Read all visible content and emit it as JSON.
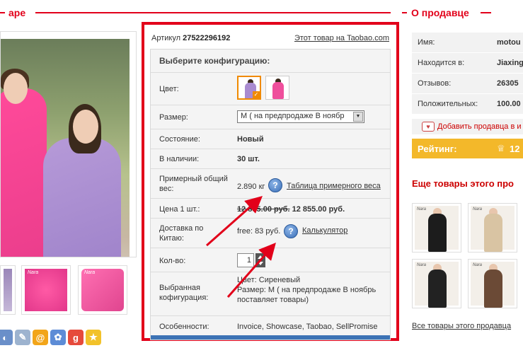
{
  "product_section": {
    "title_visible": "аре"
  },
  "seller_section": {
    "title": "О продавце"
  },
  "article": {
    "label": "Артикул",
    "number": "27522296192"
  },
  "taobao_link": "Этот товар на Taobao.com",
  "config": {
    "title": "Выберите конфигурацию:",
    "color_label": "Цвет:",
    "size_label": "Размер:",
    "size_value": "M ( на предпродаже В ноябр",
    "condition_label": "Состояние:",
    "condition_value": "Новый",
    "stock_label": "В наличии:",
    "stock_value": "30 шт.",
    "weight_label": "Примерный общий вес:",
    "weight_value": "2.890 кг",
    "weight_table_link": "Таблица примерного веса",
    "price_label": "Цена 1 шт.:",
    "price_old": "12 855.00 руб.",
    "price_new": "12 855.00 руб.",
    "delivery_label": "Доставка по Китаю:",
    "delivery_value": "free: 83 руб.",
    "calculator_link": "Калькулятор",
    "qty_label": "Кол-во:",
    "qty_value": "1",
    "selected_label": "Выбранная кофигурация:",
    "selected_color": "Цвет: Сиреневый",
    "selected_size": "Размер: M ( на предпродаже В ноябрь поставляет товары)",
    "features_label": "Особенности:",
    "features_value": "Invoice, Showcase, Taobao, SellPromise",
    "help_glyph": "?"
  },
  "seller": {
    "name_label": "Имя:",
    "name_value": "motou",
    "location_label": "Находится в:",
    "location_value": "Jiaxing",
    "reviews_label": "Отзывов:",
    "reviews_value": "26305",
    "positive_label": "Положительных:",
    "positive_value": "100.00",
    "add_seller": "Добавить продавца в и",
    "rating_label": "Рейтинг:",
    "rating_crown": "♕",
    "rating_value": "12"
  },
  "more_products": {
    "title": "Еще товары этого про",
    "all_link": "Все товары этого продавца"
  },
  "thumb_brand": "Nara",
  "share_icons": [
    {
      "name": "share-icon-1",
      "glyph": "◐",
      "color": "#6a8fc9"
    },
    {
      "name": "share-icon-2",
      "glyph": "✎",
      "color": "#9db3cf"
    },
    {
      "name": "share-icon-3",
      "glyph": "@",
      "color": "#f2a51a"
    },
    {
      "name": "share-icon-4",
      "glyph": "✿",
      "color": "#5d8cd6"
    },
    {
      "name": "share-icon-5",
      "glyph": "g",
      "color": "#e64a3b"
    },
    {
      "name": "share-icon-6",
      "glyph": "★",
      "color": "#f2c22a"
    }
  ],
  "colors": {
    "accent": "#e2001a",
    "rating_bg": "#f3b82a",
    "swatch_selected": "#f08a00"
  }
}
